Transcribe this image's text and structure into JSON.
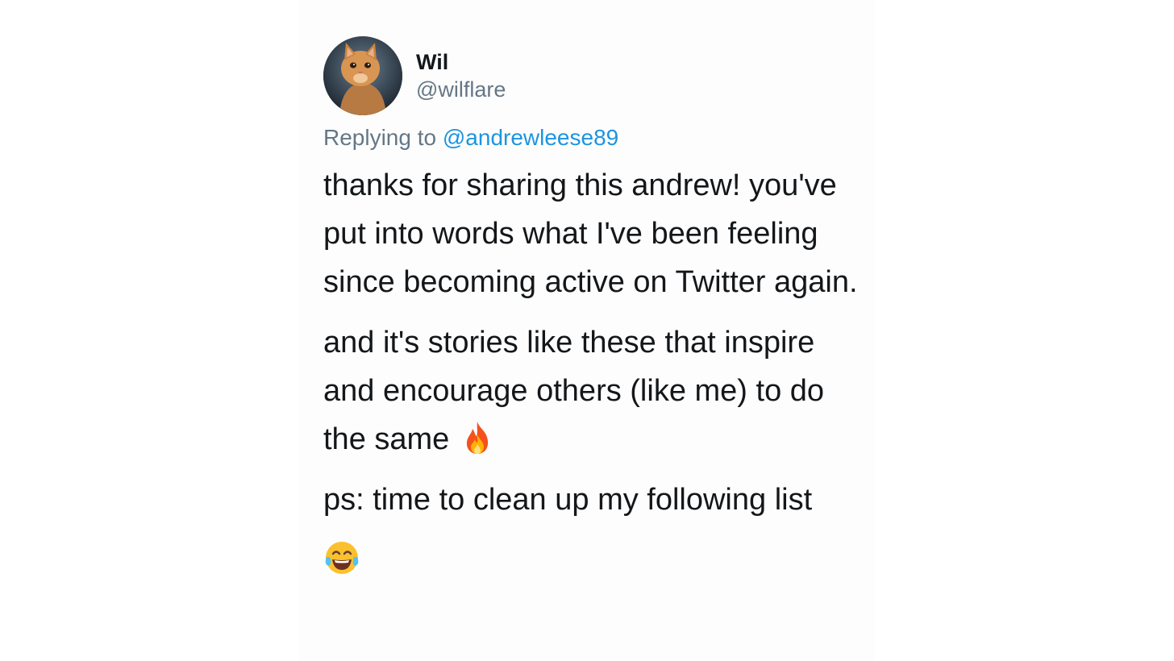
{
  "tweet": {
    "display_name": "Wil",
    "handle": "@wilflare",
    "reply_prefix": "Replying to ",
    "reply_to": "@andrewleese89",
    "paragraphs": [
      "thanks for sharing this andrew! you've put into words what I've been feeling since becoming active on Twitter again.",
      "and it's stories like these that inspire and encourage others (like me) to do the same",
      "ps: time to clean up my following list"
    ],
    "emojis": [
      "fire-emoji",
      "tears-of-joy-emoji"
    ]
  },
  "colors": {
    "text": "#14171a",
    "secondary": "#657786",
    "link": "#1b95e0",
    "background": "#ffffff"
  }
}
